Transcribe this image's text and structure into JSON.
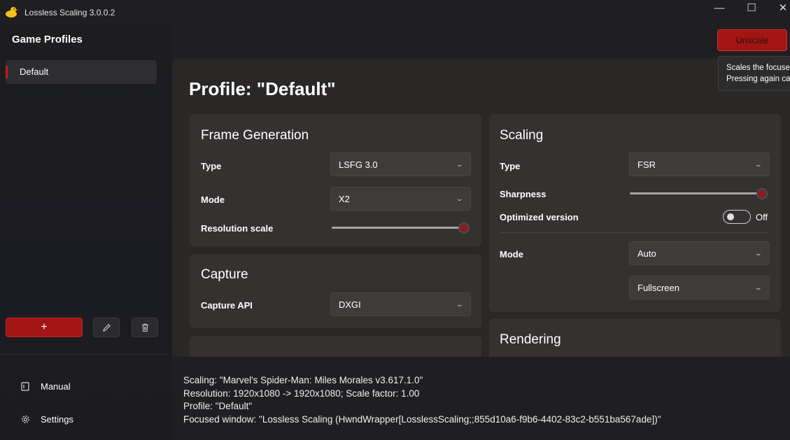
{
  "window": {
    "title": "Lossless Scaling 3.0.0.2",
    "app_icon": "duck-icon",
    "controls": {
      "minimize": "—",
      "maximize": "☐",
      "close": "✕"
    }
  },
  "sidebar": {
    "title": "Game Profiles",
    "profiles": [
      {
        "label": "Default",
        "selected": true
      }
    ],
    "add_button": "+",
    "edit_icon": "pencil-icon",
    "delete_icon": "trash-icon",
    "nav": [
      {
        "label": "Manual",
        "icon": "book-icon"
      },
      {
        "label": "Settings",
        "icon": "gear-icon"
      }
    ]
  },
  "header": {
    "unscale_button": "Unscale",
    "tooltip_lines": [
      "Scales the focused window.",
      "Pressing again cancels scaling."
    ]
  },
  "main": {
    "page_title": "Profile: \"Default\"",
    "frame_generation": {
      "title": "Frame Generation",
      "type_label": "Type",
      "type_value": "LSFG 3.0",
      "mode_label": "Mode",
      "mode_value": "X2",
      "resolution_label": "Resolution scale",
      "resolution_level_percent": 100
    },
    "capture": {
      "title": "Capture",
      "api_label": "Capture API",
      "api_value": "DXGI"
    },
    "scaling": {
      "title": "Scaling",
      "type_label": "Type",
      "type_value": "FSR",
      "sharpness_label": "Sharpness",
      "sharpness_level_percent": 100,
      "optimized_label": "Optimized version",
      "optimized_state": "Off",
      "mode_label": "Mode",
      "mode_value": "Auto",
      "mode_secondary_value": "Fullscreen"
    },
    "rendering": {
      "title": "Rendering"
    }
  },
  "status": {
    "lines": [
      "Scaling: \"Marvel's Spider-Man: Miles Morales v3.617.1.0\"",
      "Resolution: 1920x1080 -> 1920x1080; Scale factor: 1.00",
      "Profile: \"Default\"",
      "Focused window: \"Lossless Scaling (HwndWrapper[LosslessScaling;;855d10a6-f9b6-4402-83c2-b551ba567ade])\""
    ]
  },
  "colors": {
    "accent": "#a31515",
    "panel": "#2a2727",
    "card": "#353131"
  }
}
